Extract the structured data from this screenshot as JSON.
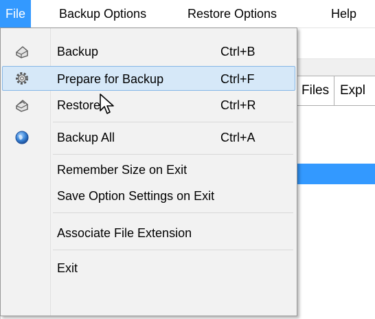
{
  "menubar": {
    "items": [
      {
        "label": "File",
        "active": true
      },
      {
        "label": "Backup Options"
      },
      {
        "label": "Restore Options"
      },
      {
        "label": "Help"
      }
    ]
  },
  "background": {
    "tabs": [
      "Files",
      "Expl"
    ]
  },
  "file_menu": {
    "items": [
      {
        "label": "Backup",
        "shortcut": "Ctrl+B",
        "icon": "backup-icon"
      },
      {
        "label": "Prepare for Backup",
        "shortcut": "Ctrl+F",
        "icon": "gear-icon",
        "hovered": true
      },
      {
        "label": "Restore",
        "shortcut": "Ctrl+R",
        "icon": "restore-icon"
      },
      {
        "label": "Backup All",
        "shortcut": "Ctrl+A",
        "icon": "globe-icon"
      },
      {
        "label": "Remember Size on Exit"
      },
      {
        "label": "Save Option Settings on Exit"
      },
      {
        "label": "Associate File Extension"
      },
      {
        "label": "Exit"
      }
    ]
  },
  "colors": {
    "accent": "#3399ff",
    "hover_fill": "#d6e8f8",
    "hover_border": "#84b6e6",
    "menu_bg": "#f2f2f2"
  }
}
